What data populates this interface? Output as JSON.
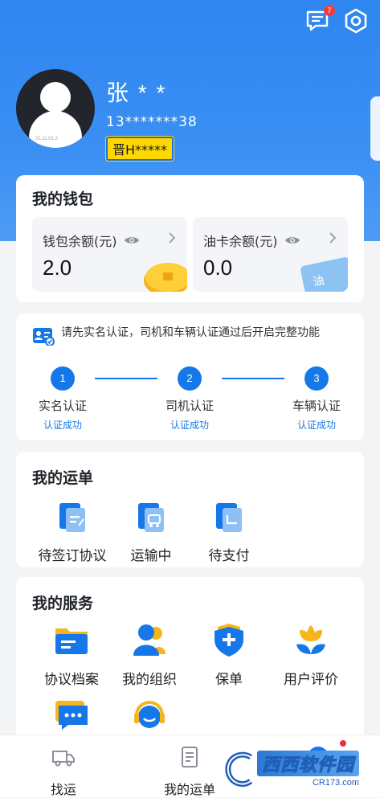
{
  "header": {
    "message_badge": "7",
    "icons": [
      "message-icon",
      "settings-icon"
    ]
  },
  "profile": {
    "name": "张 * *",
    "phone": "13*******38",
    "plate": "晋H*****",
    "avatar_caption": "21.11.01.2"
  },
  "wallet": {
    "title": "我的钱包",
    "boxes": [
      {
        "label": "钱包余额(元)",
        "value": "2.0"
      },
      {
        "label": "油卡余额(元)",
        "value": "0.0",
        "card_text": "油"
      }
    ]
  },
  "verification": {
    "notice": "请先实名认证，司机和车辆认证通过后开启完整功能",
    "steps": [
      {
        "num": "1",
        "label": "实名认证",
        "status": "认证成功"
      },
      {
        "num": "2",
        "label": "司机认证",
        "status": "认证成功"
      },
      {
        "num": "3",
        "label": "车辆认证",
        "status": "认证成功"
      }
    ]
  },
  "orders": {
    "title": "我的运单",
    "items": [
      {
        "label": "待签订协议",
        "icon": "contract-icon"
      },
      {
        "label": "运输中",
        "icon": "truck-doc-icon"
      },
      {
        "label": "待支付",
        "icon": "payment-doc-icon"
      }
    ]
  },
  "services": {
    "title": "我的服务",
    "items": [
      {
        "label": "协议档案",
        "icon": "folder-icon"
      },
      {
        "label": "我的组织",
        "icon": "organization-icon"
      },
      {
        "label": "保单",
        "icon": "shield-plus-icon"
      },
      {
        "label": "用户评价",
        "icon": "flower-icon"
      },
      {
        "label": "",
        "icon": "chat-icon"
      },
      {
        "label": "",
        "icon": "customer-service-icon"
      }
    ]
  },
  "nav": {
    "items": [
      {
        "label": "找运",
        "icon": "truck-icon"
      },
      {
        "label": "我的运单",
        "icon": "document-icon"
      },
      {
        "label": "",
        "icon": "profile-icon"
      }
    ]
  },
  "watermark": {
    "brand": "西西软件园",
    "url": "CR173.com"
  },
  "colors": {
    "primary": "#1677e8",
    "header": "#2f86f0",
    "plate_bg": "#ffd700",
    "badge": "#f23c3c"
  }
}
